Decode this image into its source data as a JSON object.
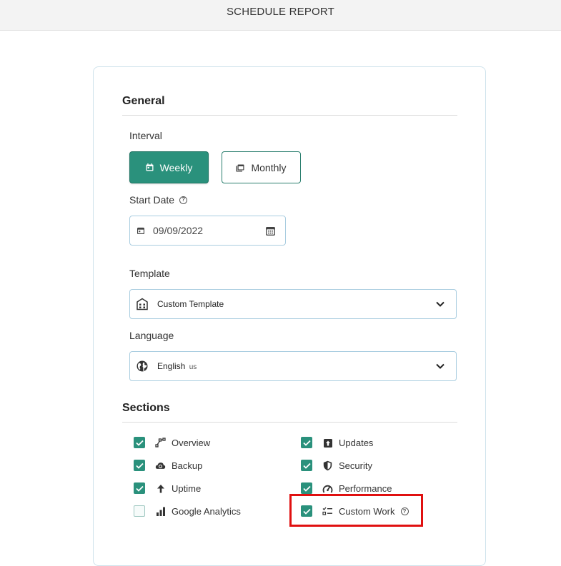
{
  "header": {
    "title": "SCHEDULE REPORT"
  },
  "general": {
    "title": "General",
    "interval": {
      "label": "Interval",
      "weekly_label": "Weekly",
      "monthly_label": "Monthly",
      "selected": "Weekly"
    },
    "start_date": {
      "label": "Start Date",
      "value": "09/09/2022"
    },
    "template": {
      "label": "Template",
      "value": "Custom Template"
    },
    "language": {
      "label": "Language",
      "value": "English",
      "sub": "us"
    }
  },
  "sections": {
    "title": "Sections",
    "items": [
      {
        "label": "Overview",
        "checked": true,
        "icon": "overview-icon"
      },
      {
        "label": "Backup",
        "checked": true,
        "icon": "cloud-backup-icon"
      },
      {
        "label": "Uptime",
        "checked": true,
        "icon": "arrow-up-icon"
      },
      {
        "label": "Google Analytics",
        "checked": false,
        "icon": "bar-chart-icon"
      },
      {
        "label": "Updates",
        "checked": true,
        "icon": "updates-icon"
      },
      {
        "label": "Security",
        "checked": true,
        "icon": "shield-icon"
      },
      {
        "label": "Performance",
        "checked": true,
        "icon": "gauge-icon"
      },
      {
        "label": "Custom Work",
        "checked": true,
        "icon": "checklist-icon"
      }
    ]
  },
  "colors": {
    "accent": "#2a917c",
    "highlight": "#e01010",
    "border": "#a9cde0"
  }
}
